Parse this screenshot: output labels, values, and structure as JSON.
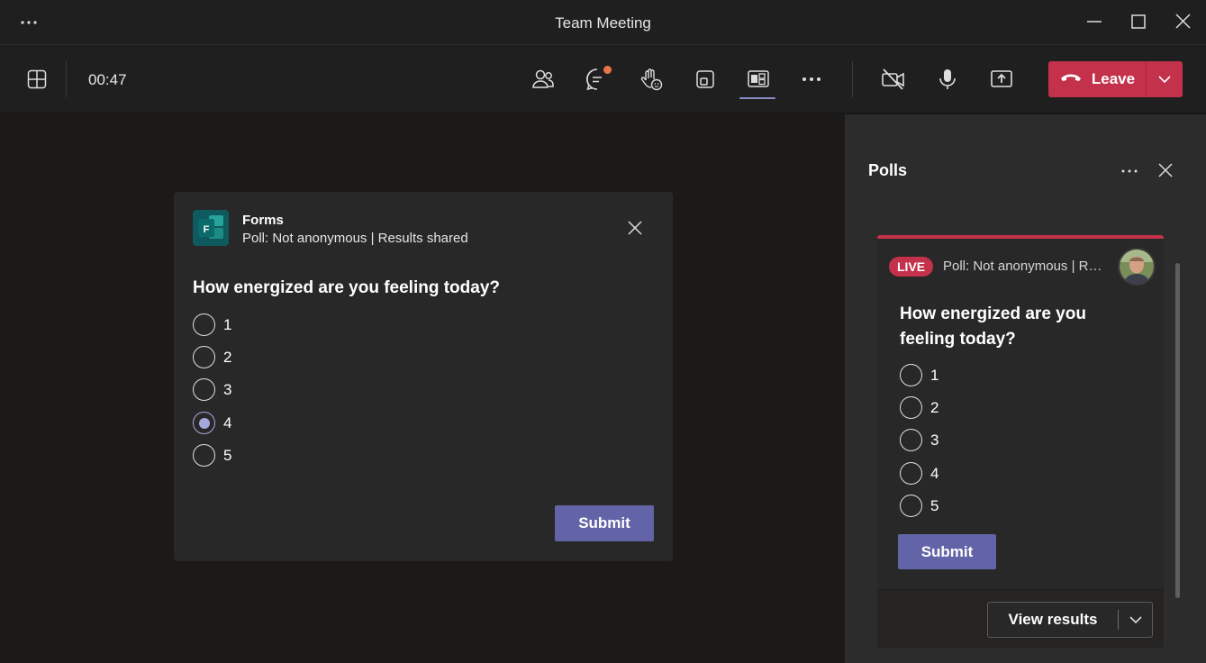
{
  "window": {
    "title": "Team Meeting",
    "more_icon": "more-horizontal-icon",
    "controls": [
      "minimize-icon",
      "maximize-icon",
      "close-icon"
    ]
  },
  "toolbar": {
    "timer": "00:47",
    "layout_icon": "grid-layout-icon",
    "buttons": [
      "people-icon",
      "chat-icon",
      "raise-hand-icon",
      "rooms-icon",
      "apps-icon",
      "more-icon",
      "camera-off-icon",
      "microphone-icon",
      "share-screen-icon"
    ],
    "leave_label": "Leave",
    "leave_color": "#c4314b"
  },
  "form_card": {
    "app_name": "Forms",
    "subtitle": "Poll: Not anonymous | Results shared",
    "question": "How energized are you feeling today?",
    "options": [
      "1",
      "2",
      "3",
      "4",
      "5"
    ],
    "selected": "4",
    "submit_label": "Submit",
    "accent": "#6264a7"
  },
  "polls_panel": {
    "title": "Polls",
    "status": "LIVE",
    "meta": "Poll: Not anonymous | Results shared",
    "question": "How energized are you feeling today?",
    "options": [
      "1",
      "2",
      "3",
      "4",
      "5"
    ],
    "submit_label": "Submit",
    "view_results_label": "View results"
  }
}
